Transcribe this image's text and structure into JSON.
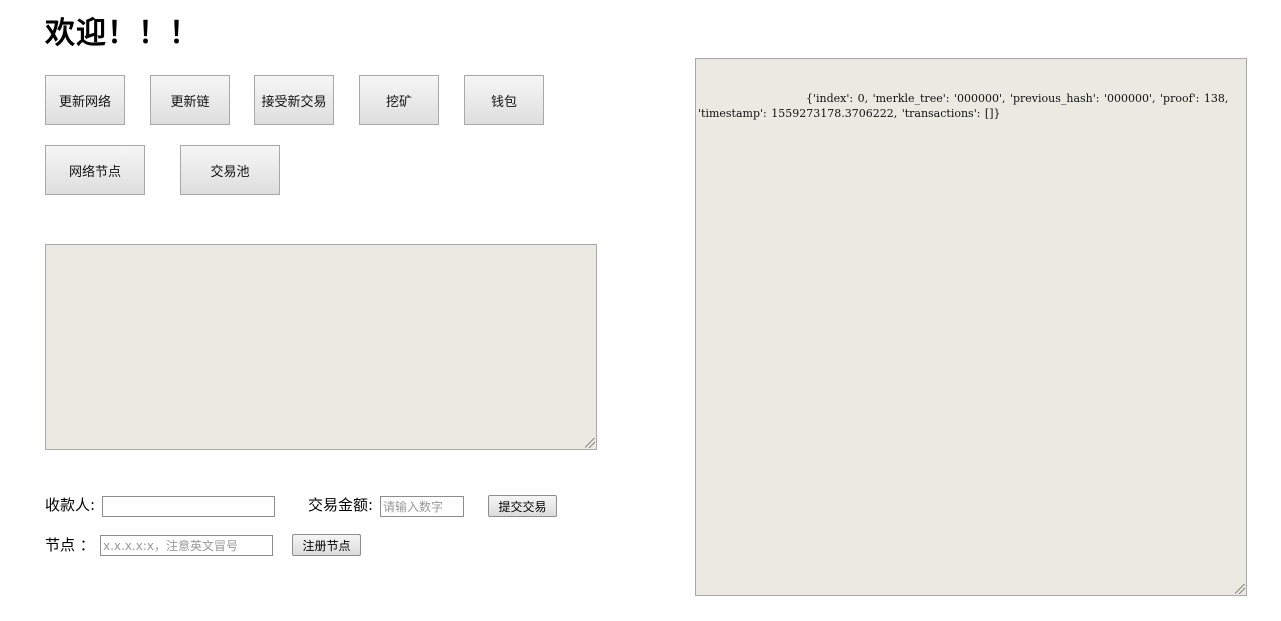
{
  "title": "欢迎！！！",
  "toolbar": {
    "update_network": "更新网络",
    "update_chain": "更新链",
    "accept_tx": "接受新交易",
    "mine": "挖矿",
    "wallet": "钱包",
    "network_nodes": "网络节点",
    "tx_pool": "交易池"
  },
  "output_left": {
    "text": ""
  },
  "output_right": {
    "text": "{'index': 0, 'merkle_tree': '000000', 'previous_hash': '000000', 'proof': 138, 'timestamp': 1559273178.3706222, 'transactions': []}"
  },
  "transaction_form": {
    "recipient_label": "收款人:",
    "recipient_value": "",
    "amount_label": "交易金额:",
    "amount_placeholder": "请输入数字",
    "submit_label": "提交交易"
  },
  "node_form": {
    "node_label": "节点 ：",
    "node_placeholder": "x.x.x.x:x，注意英文冒号",
    "register_label": "注册节点"
  }
}
